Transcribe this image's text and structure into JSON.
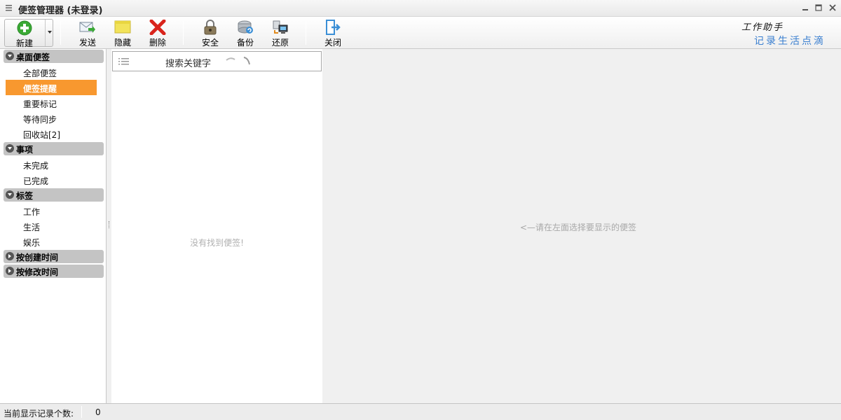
{
  "window": {
    "title": "便签管理器 (未登录)",
    "controls": [
      "minimize-icon",
      "maximize-icon",
      "close-icon"
    ]
  },
  "toolbar": {
    "new_label": "新建",
    "buttons": [
      {
        "name": "send",
        "label": "发送",
        "icon": "send-mail-icon"
      },
      {
        "name": "hide",
        "label": "隐藏",
        "icon": "sticky-note-icon"
      },
      {
        "name": "delete",
        "label": "删除",
        "icon": "red-x-icon"
      },
      {
        "name": "security",
        "label": "安全",
        "icon": "padlock-icon"
      },
      {
        "name": "backup",
        "label": "备份",
        "icon": "backup-drive-icon"
      },
      {
        "name": "restore",
        "label": "还原",
        "icon": "restore-icon"
      },
      {
        "name": "close",
        "label": "关闭",
        "icon": "exit-door-icon"
      }
    ],
    "brand_line1": "工作助手",
    "brand_line2": "记录生活点滴"
  },
  "sidebar": {
    "groups": [
      {
        "label": "桌面便签",
        "expanded": true,
        "items": [
          "全部便签",
          "便签提醒",
          "重要标记",
          "等待同步",
          "回收站[2]"
        ]
      },
      {
        "label": "事项",
        "expanded": true,
        "items": [
          "未完成",
          "已完成"
        ]
      },
      {
        "label": "标签",
        "expanded": true,
        "items": [
          "工作",
          "生活",
          "娱乐"
        ]
      },
      {
        "label": "按创建时间",
        "expanded": false,
        "items": []
      },
      {
        "label": "按修改时间",
        "expanded": false,
        "items": []
      }
    ],
    "active_item": "便签提醒"
  },
  "list": {
    "search_placeholder": "搜索关键字",
    "empty_message": "没有找到便签!"
  },
  "detail": {
    "hint": "<—请在左面选择要显示的便签"
  },
  "status": {
    "label": "当前显示记录个数:",
    "count": "0"
  },
  "colors": {
    "active_item_bg": "#f8982f",
    "group_header_bg": "#c4c4c4",
    "brand_blue": "#3a7fd0",
    "new_button_green": "#3aa935",
    "delete_red": "#d9241c"
  }
}
